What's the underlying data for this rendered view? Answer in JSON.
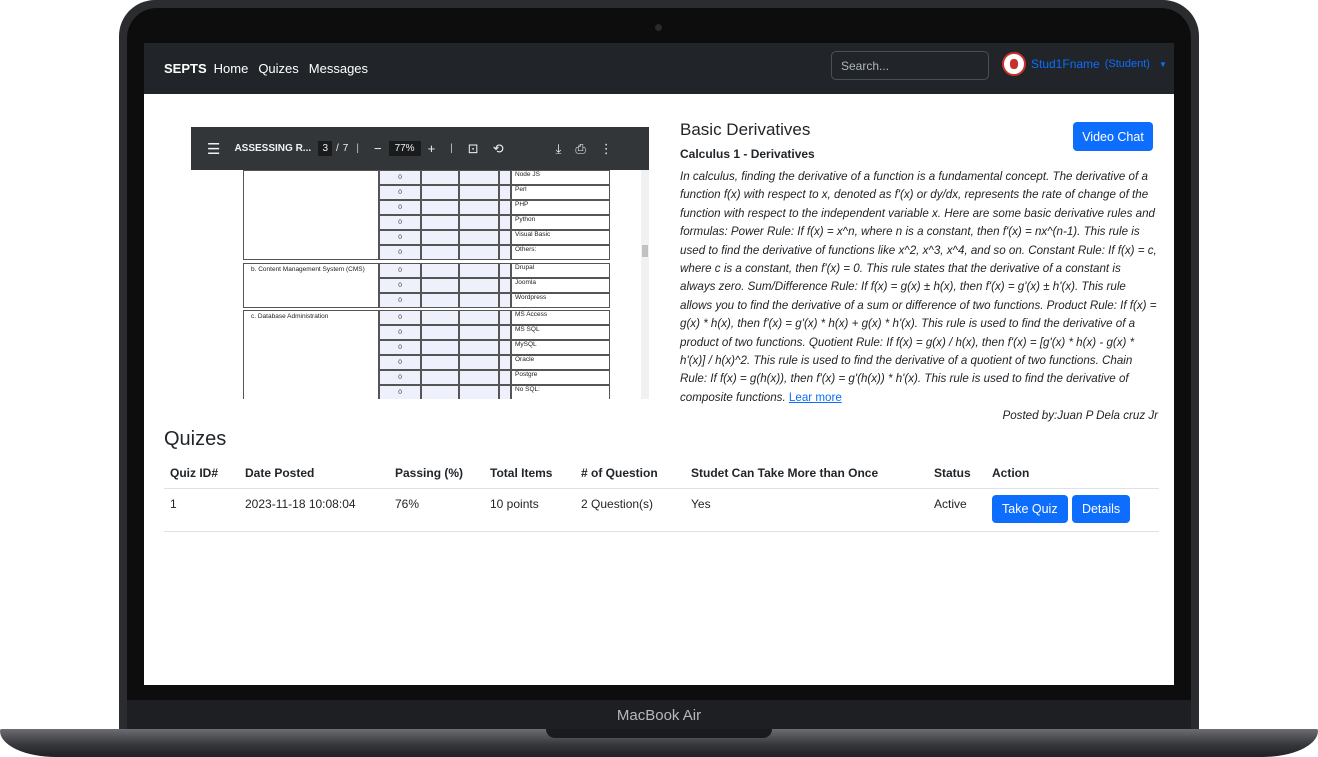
{
  "device": {
    "label": "MacBook Air"
  },
  "navbar": {
    "brand": "SEPTS",
    "links": [
      "Home",
      "Quizes",
      "Messages"
    ],
    "search_placeholder": "Search...",
    "user_name": "Stud1Fname",
    "user_role": "(Student)"
  },
  "pdf": {
    "title": "ASSESSING R...",
    "page_current": "3",
    "page_total": "7",
    "zoom": "77%",
    "rows_top": [
      {
        "value": "0",
        "label": "Node JS"
      },
      {
        "value": "0",
        "label": "Perl"
      },
      {
        "value": "0",
        "label": "PHP"
      },
      {
        "value": "0",
        "label": "Python"
      },
      {
        "value": "0",
        "label": "Visual Basic"
      },
      {
        "value": "0",
        "label": "Others:"
      }
    ],
    "section_b": "b.    Content Management System (CMS)",
    "rows_b": [
      {
        "value": "0",
        "label": "Drupal"
      },
      {
        "value": "0",
        "label": "Joomla"
      },
      {
        "value": "0",
        "label": "Wordpress"
      }
    ],
    "section_c": "c.    Database Administration",
    "rows_c": [
      {
        "value": "0",
        "label": "MS Access"
      },
      {
        "value": "0",
        "label": "MS SQL"
      },
      {
        "value": "0",
        "label": "MySQL"
      },
      {
        "value": "0",
        "label": "Oracle"
      },
      {
        "value": "0",
        "label": "Postgre"
      },
      {
        "value": "0",
        "label": "No SQL:"
      }
    ]
  },
  "article": {
    "title": "Basic Derivatives",
    "subtitle": "Calculus 1 - Derivatives",
    "body": "In calculus, finding the derivative of a function is a fundamental concept. The derivative of a function f(x) with respect to x, denoted as f'(x) or dy/dx, represents the rate of change of the function with respect to the independent variable x. Here are some basic derivative rules and formulas: Power Rule: If f(x) = x^n, where n is a constant, then f'(x) = nx^(n-1). This rule is used to find the derivative of functions like x^2, x^3, x^4, and so on. Constant Rule: If f(x) = c, where c is a constant, then f'(x) = 0. This rule states that the derivative of a constant is always zero. Sum/Difference Rule: If f(x) = g(x) ± h(x), then f'(x) = g'(x) ± h'(x). This rule allows you to find the derivative of a sum or difference of two functions. Product Rule: If f(x) = g(x) * h(x), then f'(x) = g'(x) * h(x) + g(x) * h'(x). This rule is used to find the derivative of a product of two functions. Quotient Rule: If f(x) = g(x) / h(x), then f'(x) = [g'(x) * h(x) - g(x) * h'(x)] / h(x)^2. This rule is used to find the derivative of a quotient of two functions. Chain Rule: If f(x) = g(h(x)), then f'(x) = g'(h(x)) * h'(x). This rule is used to find the derivative of composite functions.",
    "learn_more": "Lear more",
    "video_chat": "Video Chat",
    "posted_by": "Posted by:Juan P Dela cruz Jr"
  },
  "quizes": {
    "heading": "Quizes",
    "columns": [
      "Quiz ID#",
      "Date Posted",
      "Passing (%)",
      "Total Items",
      "# of Question",
      "Studet Can Take More than Once",
      "Status",
      "Action"
    ],
    "rows": [
      {
        "id": "1",
        "date": "2023-11-18 10:08:04",
        "passing": "76%",
        "total": "10 points",
        "questions": "2 Question(s)",
        "retake": "Yes",
        "status": "Active",
        "take_label": "Take Quiz",
        "details_label": "Details"
      }
    ]
  }
}
